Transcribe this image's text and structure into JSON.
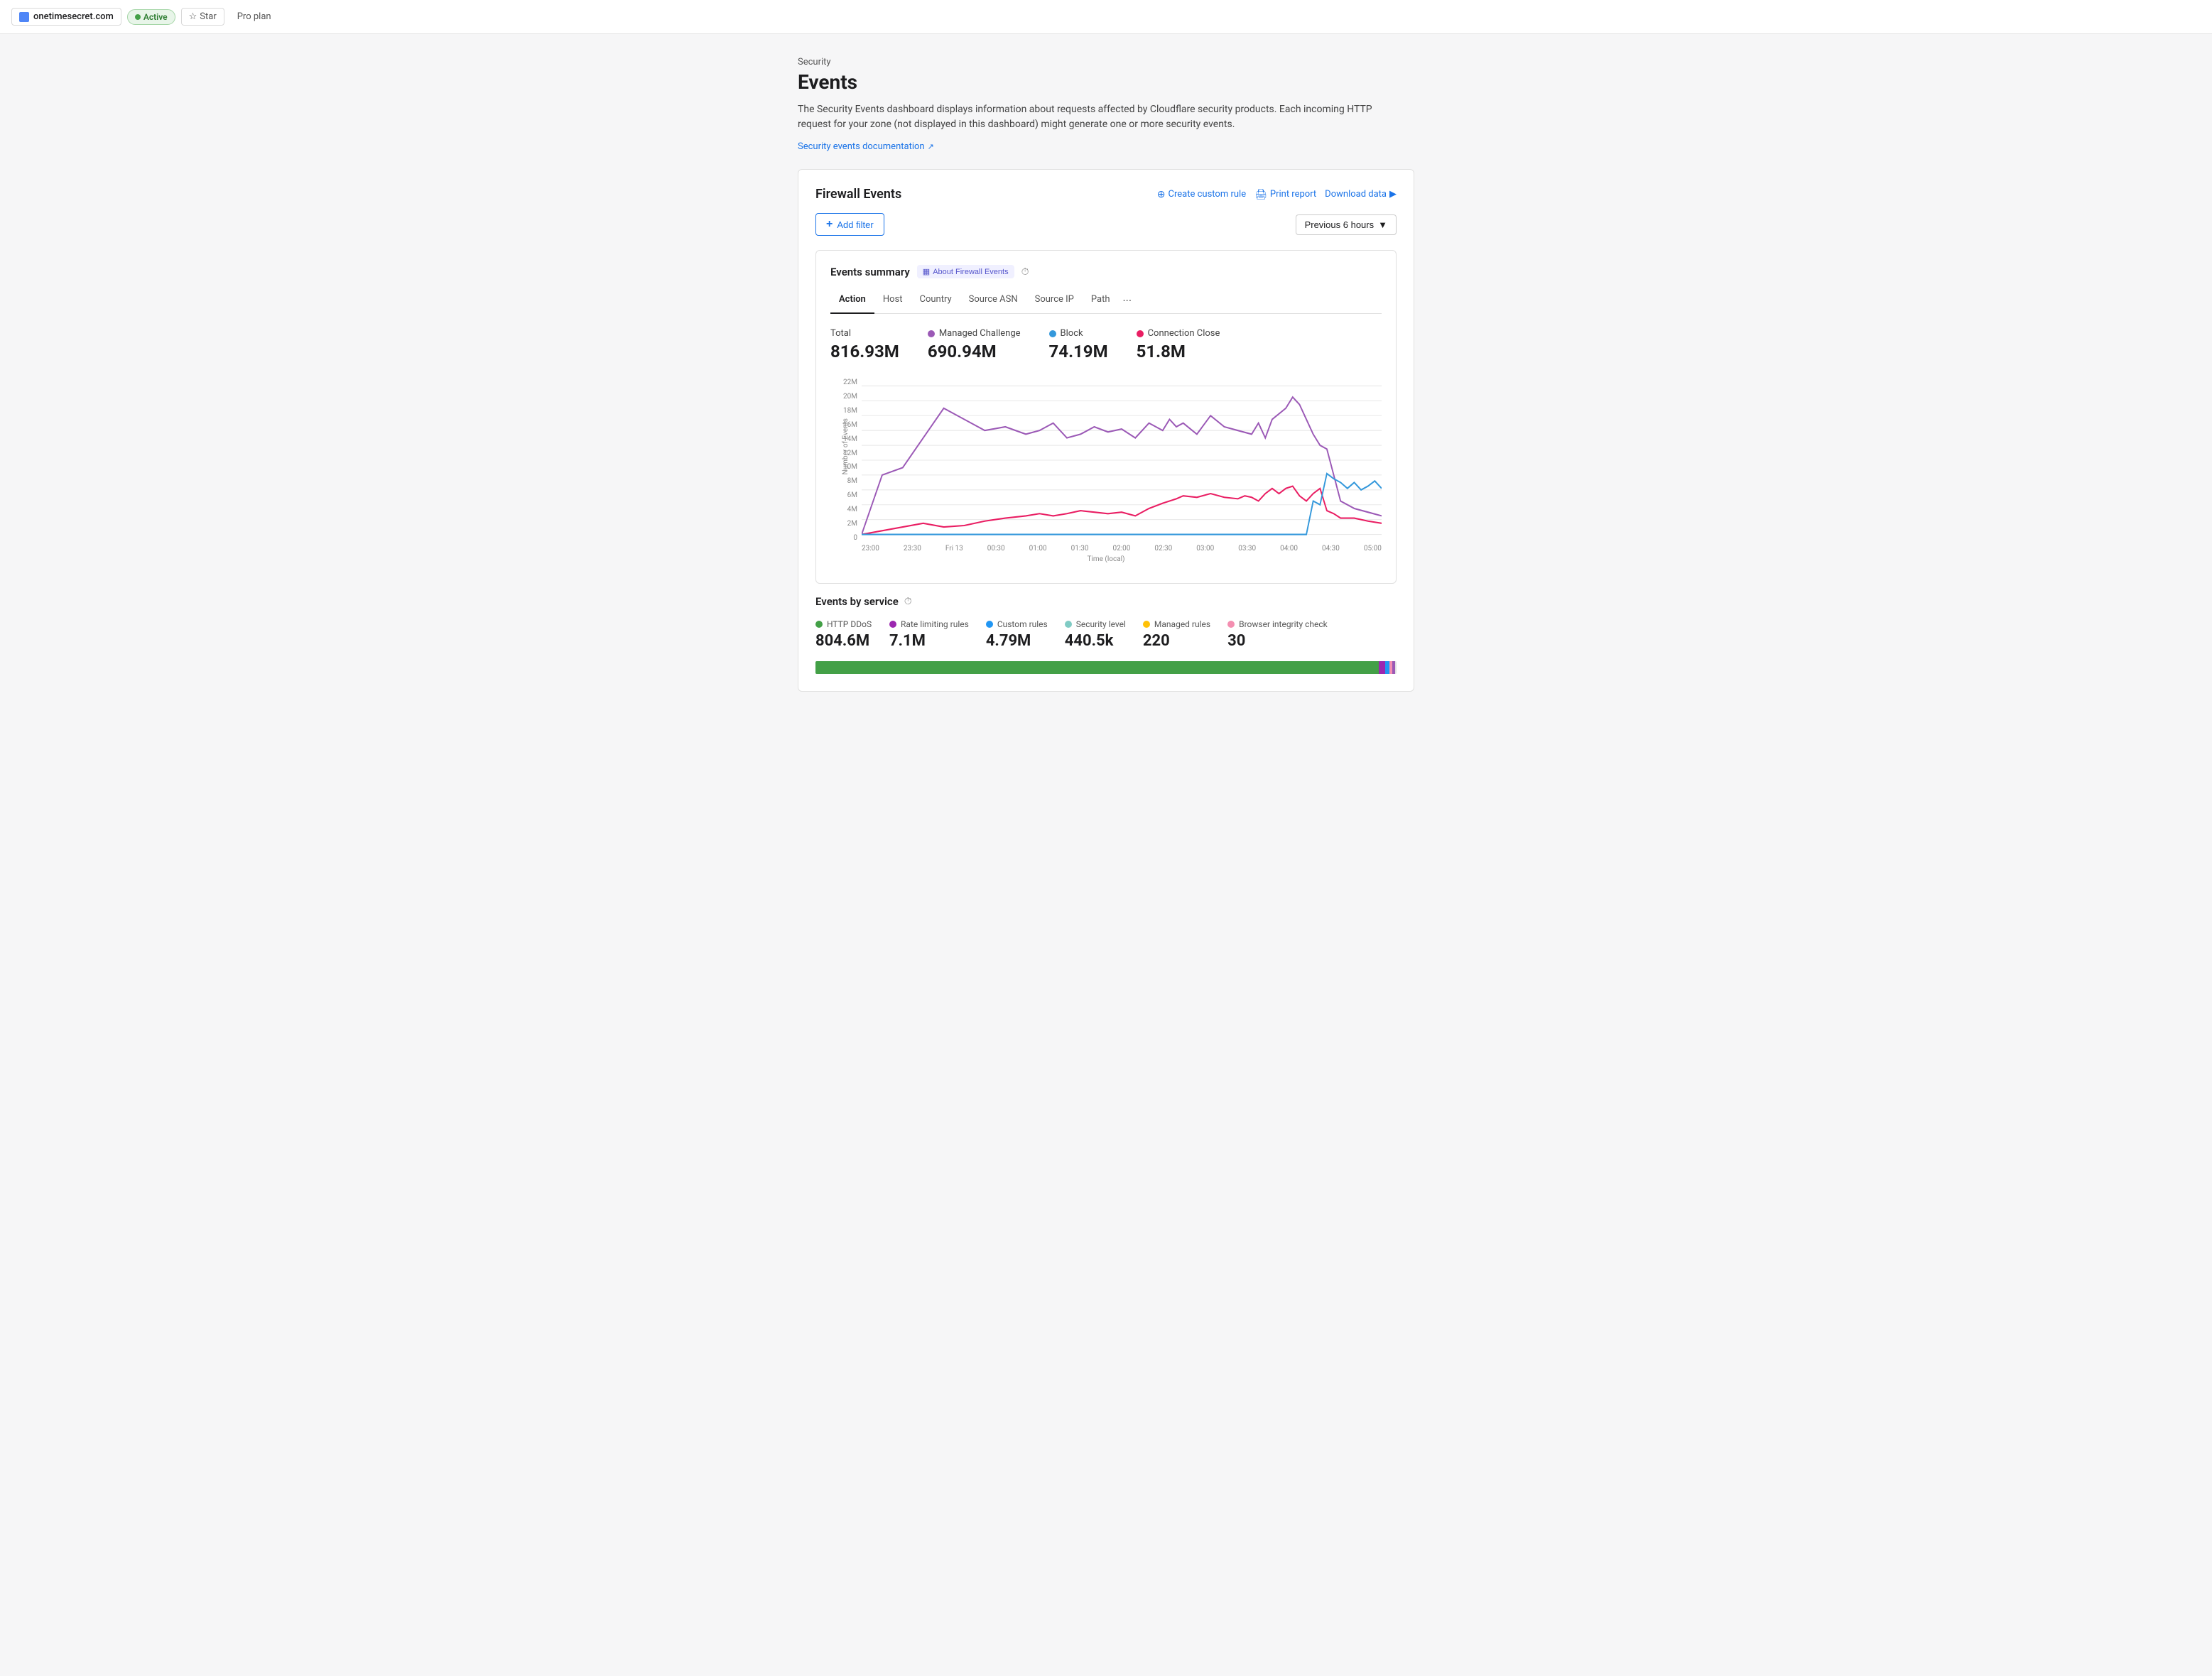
{
  "topbar": {
    "site": "onetimesecret.com",
    "active_label": "Active",
    "star_label": "Star",
    "plan_label": "Pro plan"
  },
  "page": {
    "section": "Security",
    "title": "Events",
    "description": "The Security Events dashboard displays information about requests affected by Cloudflare security products. Each incoming HTTP request for your zone (not displayed in this dashboard) might generate one or more security events.",
    "doc_link": "Security events documentation"
  },
  "firewall": {
    "title": "Firewall Events",
    "create_rule": "Create custom rule",
    "print_report": "Print report",
    "download_data": "Download data",
    "add_filter": "Add filter",
    "time_range": "Previous 6 hours"
  },
  "events_summary": {
    "label": "Events summary",
    "about_label": "About Firewall Events",
    "tabs": [
      "Action",
      "Host",
      "Country",
      "Source ASN",
      "Source IP",
      "Path",
      "..."
    ],
    "stats": {
      "total": {
        "label": "Total",
        "value": "816.93M",
        "color": ""
      },
      "managed_challenge": {
        "label": "Managed Challenge",
        "value": "690.94M",
        "color": "#9b59b6"
      },
      "block": {
        "label": "Block",
        "value": "74.19M",
        "color": "#3498db"
      },
      "connection_close": {
        "label": "Connection Close",
        "value": "51.8M",
        "color": "#e91e63"
      }
    }
  },
  "chart": {
    "y_labels": [
      "22M",
      "20M",
      "18M",
      "16M",
      "14M",
      "12M",
      "10M",
      "8M",
      "6M",
      "4M",
      "2M",
      "0"
    ],
    "x_labels": [
      "23:00",
      "23:30",
      "Fri 13",
      "00:30",
      "01:00",
      "01:30",
      "02:00",
      "02:30",
      "03:00",
      "03:30",
      "04:00",
      "04:30",
      "05:00"
    ],
    "x_axis_label": "Time (local)",
    "y_axis_label": "Number of Events"
  },
  "events_by_service": {
    "title": "Events by service",
    "items": [
      {
        "label": "HTTP DDoS",
        "value": "804.6M",
        "color": "#43a047",
        "pct": 97
      },
      {
        "label": "Rate limiting rules",
        "value": "7.1M",
        "color": "#9c27b0",
        "pct": 1
      },
      {
        "label": "Custom rules",
        "value": "4.79M",
        "color": "#2196f3",
        "pct": 0.6
      },
      {
        "label": "Security level",
        "value": "440.5k",
        "color": "#80cbc4",
        "pct": 0.05
      },
      {
        "label": "Managed rules",
        "value": "220",
        "color": "#ffc107",
        "pct": 0.003
      },
      {
        "label": "Browser integrity check",
        "value": "30",
        "color": "#f48fb1",
        "pct": 0.001
      }
    ]
  }
}
